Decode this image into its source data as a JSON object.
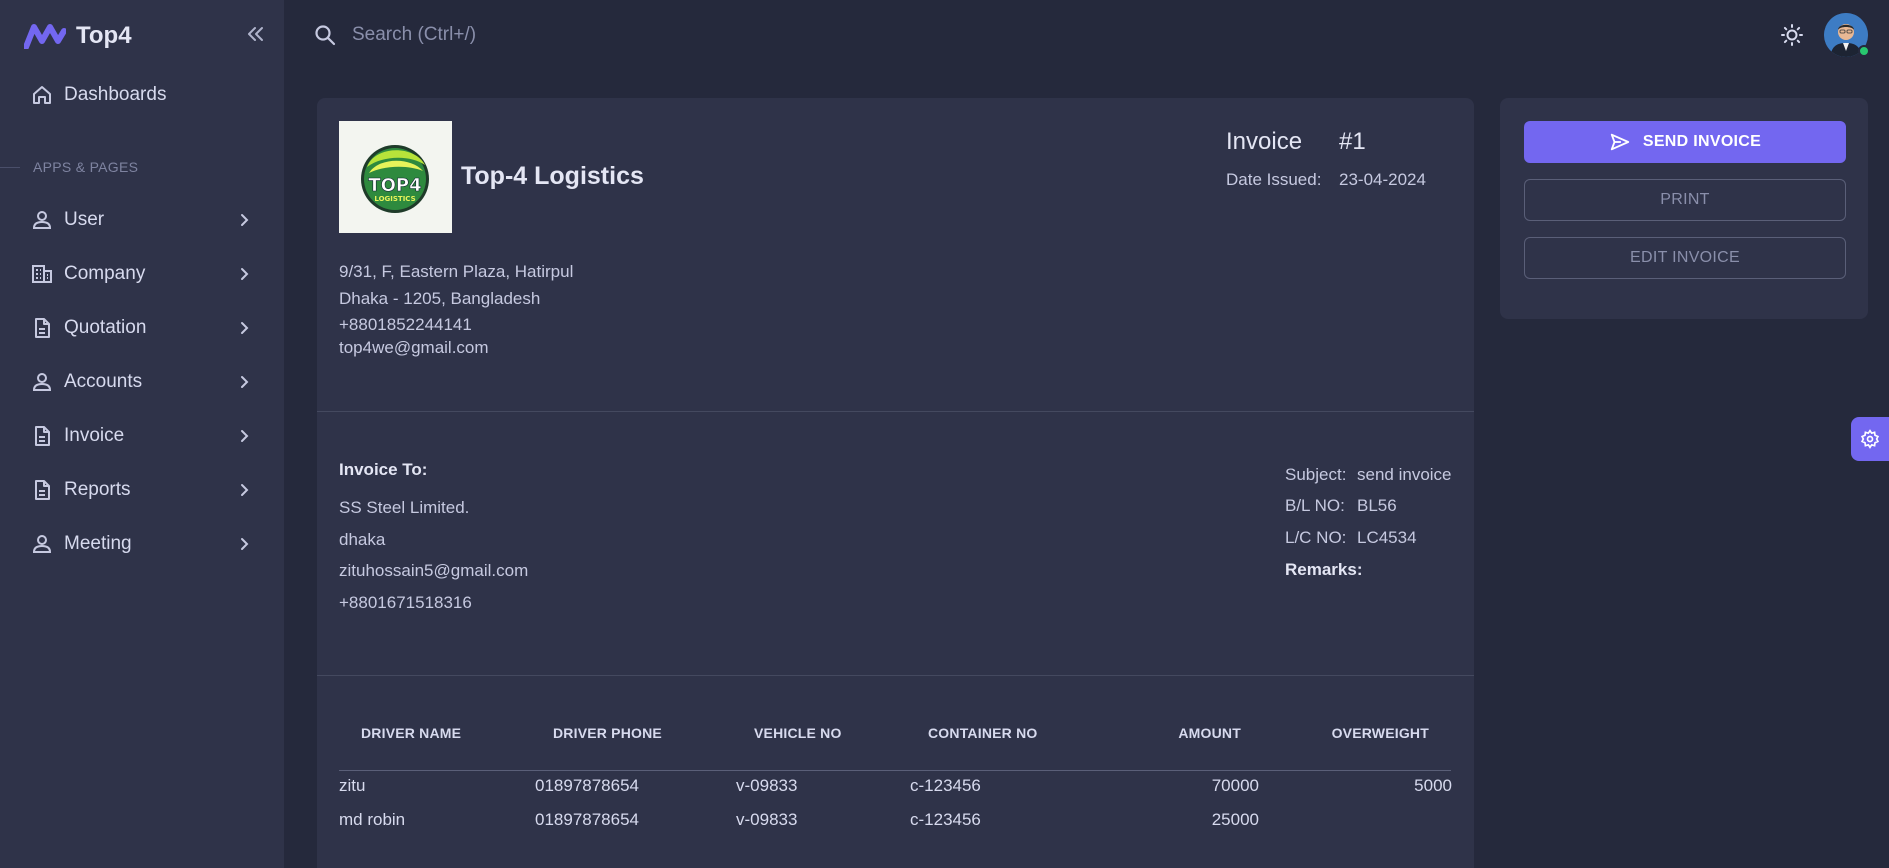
{
  "brand": {
    "name": "Top4"
  },
  "search": {
    "placeholder": "Search (Ctrl+/)"
  },
  "sidebar": {
    "top_item": {
      "label": "Dashboards",
      "icon": "home-icon"
    },
    "section_label": "APPS & PAGES",
    "items": [
      {
        "label": "User",
        "icon": "user-icon"
      },
      {
        "label": "Company",
        "icon": "building-icon"
      },
      {
        "label": "Quotation",
        "icon": "document-icon"
      },
      {
        "label": "Accounts",
        "icon": "user-icon"
      },
      {
        "label": "Invoice",
        "icon": "document-icon"
      },
      {
        "label": "Reports",
        "icon": "document-icon"
      },
      {
        "label": "Meeting",
        "icon": "user-icon"
      }
    ]
  },
  "invoice": {
    "company_name": "Top-4 Logistics",
    "logo_text": "TOP4",
    "logo_sub": "LOGISTICS",
    "address": [
      "9/31, F, Eastern Plaza, Hatirpul",
      "Dhaka - 1205, Bangladesh",
      "+8801852244141",
      "top4we@gmail.com"
    ],
    "title": "Invoice",
    "number": "#1",
    "date_label": "Date Issued:",
    "date_value": "23-04-2024",
    "to_label": "Invoice To:",
    "to_lines": [
      "SS Steel Limited.",
      "dhaka",
      "zituhossain5@gmail.com",
      "+8801671518316"
    ],
    "meta": [
      {
        "label": "Subject:",
        "value": "send invoice"
      },
      {
        "label": "B/L NO:",
        "value": "BL56"
      },
      {
        "label": "L/C NO:",
        "value": "LC4534"
      }
    ],
    "remarks_label": "Remarks:",
    "table": {
      "headers": [
        "DRIVER NAME",
        "DRIVER PHONE",
        "VEHICLE NO",
        "CONTAINER NO",
        "AMOUNT",
        "OVERWEIGHT"
      ],
      "rows": [
        [
          "zitu",
          "01897878654",
          "v-09833",
          "c-123456",
          "70000",
          "5000"
        ],
        [
          "md robin",
          "01897878654",
          "v-09833",
          "c-123456",
          "25000",
          ""
        ]
      ]
    }
  },
  "actions": {
    "send": "SEND INVOICE",
    "print": "PRINT",
    "edit": "EDIT INVOICE"
  },
  "colors": {
    "accent": "#7367f0",
    "background": "#25293c",
    "card": "#2f3349",
    "online": "#28c76f"
  }
}
